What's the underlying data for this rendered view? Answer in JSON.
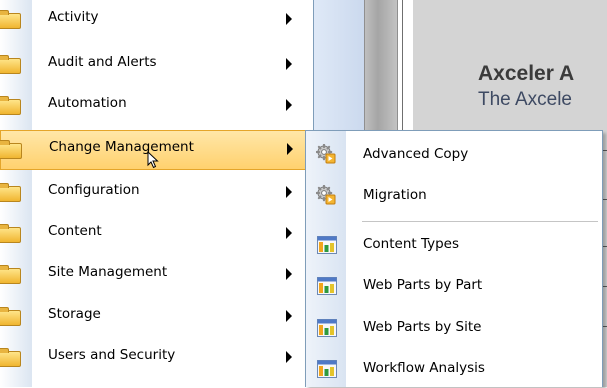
{
  "background": {
    "title": "Axceler A",
    "subtitle": "The Axcele"
  },
  "main_menu": {
    "items": [
      {
        "label": "Activity"
      },
      {
        "label": "Audit and Alerts"
      },
      {
        "label": "Automation"
      },
      {
        "label": "Change Management",
        "highlighted": true
      },
      {
        "label": "Configuration"
      },
      {
        "label": "Content"
      },
      {
        "label": "Site Management"
      },
      {
        "label": "Storage"
      },
      {
        "label": "Users and Security"
      }
    ]
  },
  "submenu": {
    "parent": "Change Management",
    "items": [
      {
        "label": "Advanced Copy",
        "icon": "gear-icon"
      },
      {
        "label": "Migration",
        "icon": "gear-icon"
      },
      {
        "label": "Content Types",
        "icon": "report-icon"
      },
      {
        "label": "Web Parts by Part",
        "icon": "report-icon"
      },
      {
        "label": "Web Parts by Site",
        "icon": "report-icon"
      },
      {
        "label": "Workflow Analysis",
        "icon": "report-icon"
      }
    ]
  },
  "colors": {
    "highlight": "#ffd16e",
    "highlight_border": "#e4a52a",
    "menu_border": "#7f9db9",
    "folder": "#f0b530"
  }
}
